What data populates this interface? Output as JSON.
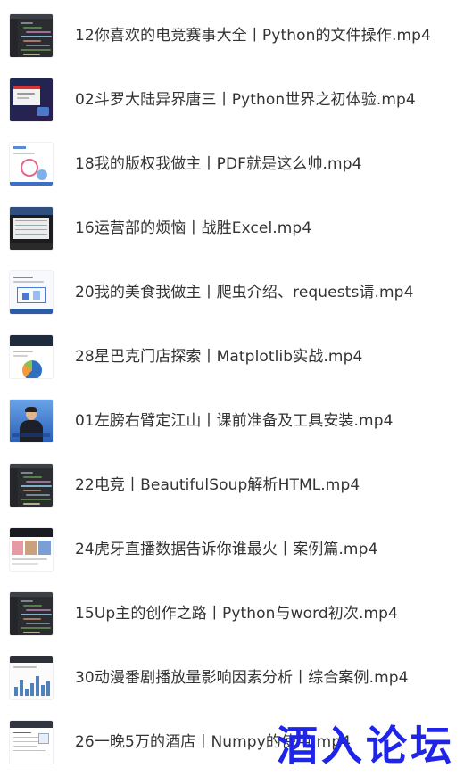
{
  "file_list": {
    "items": [
      {
        "name": "12你喜欢的电竞赛事大全丨Python的文件操作.mp4",
        "thumb": "dark-code-editor"
      },
      {
        "name": "02斗罗大陆异界唐三丨Python世界之初体验.mp4",
        "thumb": "dark-slide-with-window"
      },
      {
        "name": "18我的版权我做主丨PDF就是这么帅.mp4",
        "thumb": "white-slide-with-diagram"
      },
      {
        "name": "16运营部的烦恼丨战胜Excel.mp4",
        "thumb": "dark-window-with-sheet"
      },
      {
        "name": "20我的美食我做主丨爬虫介绍、requests请.mp4",
        "thumb": "white-slide-with-chart"
      },
      {
        "name": "28星巴克门店探索丨Matplotlib实战.mp4",
        "thumb": "dark-header-with-pie"
      },
      {
        "name": "01左膀右臂定江山丨课前准备及工具安装.mp4",
        "thumb": "presenter-on-blue"
      },
      {
        "name": "22电竞丨BeautifulSoup解析HTML.mp4",
        "thumb": "dark-code-editor"
      },
      {
        "name": "24虎牙直播数据告诉你谁最火丨案例篇.mp4",
        "thumb": "dark-header-with-photos"
      },
      {
        "name": "15Up主的创作之路丨Python与word初次.mp4",
        "thumb": "dark-code-editor"
      },
      {
        "name": "30动漫番剧播放量影响因素分析丨综合案例.mp4",
        "thumb": "white-page-with-bars"
      },
      {
        "name": "26一晚5万的酒店丨Numpy的使用.mp4",
        "thumb": "white-page-with-table"
      }
    ]
  },
  "watermark": {
    "text": "酒入论坛",
    "color": "#1f25e8"
  }
}
